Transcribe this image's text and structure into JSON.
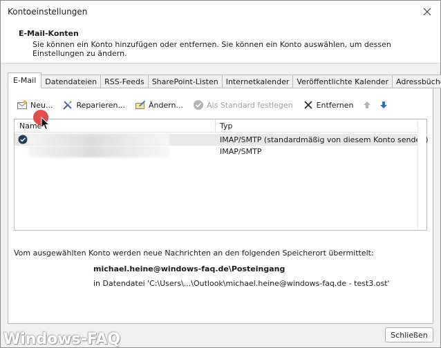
{
  "window": {
    "title": "Kontoeinstellungen"
  },
  "header": {
    "title": "E-Mail-Konten",
    "description": "Sie können ein Konto hinzufügen oder entfernen. Sie können ein Konto auswählen, um dessen Einstellungen zu ändern."
  },
  "tabs": [
    {
      "label": "E-Mail",
      "active": true
    },
    {
      "label": "Datendateien"
    },
    {
      "label": "RSS-Feeds"
    },
    {
      "label": "SharePoint-Listen"
    },
    {
      "label": "Internetkalender"
    },
    {
      "label": "Veröffentlichte Kalender"
    },
    {
      "label": "Adressbücher"
    }
  ],
  "toolbar": {
    "new_label": "Neu...",
    "repair_label": "Reparieren...",
    "change_label": "Ändern...",
    "set_default_label": "Als Standard festlegen",
    "remove_label": "Entfernen"
  },
  "account_list": {
    "columns": {
      "name": "Name",
      "type": "Typ"
    },
    "rows": [
      {
        "type": "IMAP/SMTP (standardmäßig von diesem Konto senden)",
        "default": true
      },
      {
        "type": "IMAP/SMTP",
        "default": false
      }
    ]
  },
  "delivery": {
    "info_text": "Vom ausgewählten Konto werden neue Nachrichten an den folgenden Speicherort übermittelt:",
    "folder_path": "michael.heine@windows-faq.de\\Posteingang",
    "datafile_text": "in Datendatei 'C:\\Users\\...\\Outlook\\michael.heine@windows-faq.de - test3.ost'"
  },
  "footer": {
    "close_label": "Schließen"
  },
  "watermark": "Windows-FAQ",
  "colors": {
    "accent_blue": "#1e6fd9",
    "check_dark": "#1f3b5c",
    "disabled_gray": "#a0a0a0",
    "cursor_red": "#e23a3a"
  }
}
